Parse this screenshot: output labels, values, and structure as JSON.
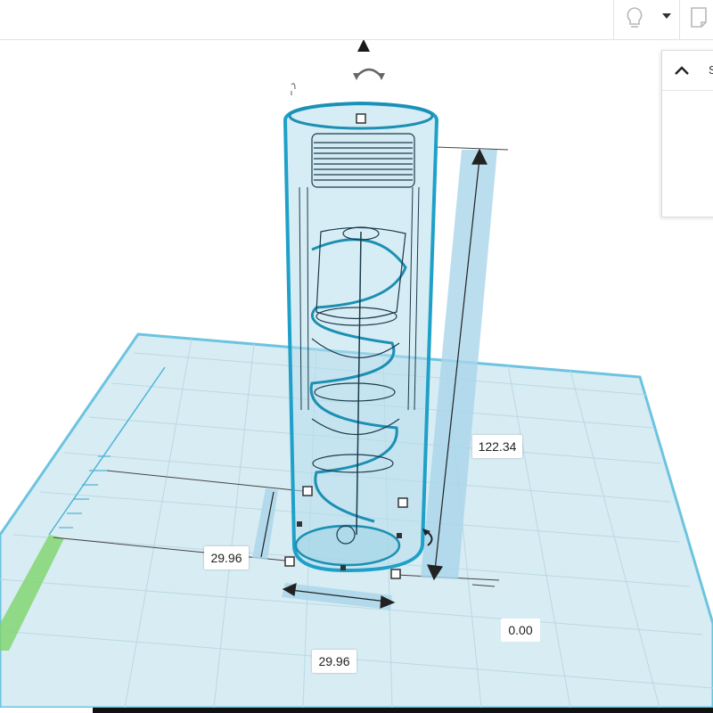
{
  "toolbar": {
    "hint_icon": "lightbulb-icon",
    "menu_icon": "caret-down-icon",
    "notes_icon": "notes-icon"
  },
  "shape_panel": {
    "title": "S",
    "collapse_icon": "chevron-up-icon"
  },
  "dimensions": {
    "height": "122.34",
    "width": "29.96",
    "depth": "29.96",
    "elevation": "0.00"
  },
  "colors": {
    "workplane": "#d8ecf3",
    "grid_line": "#b9d9e6",
    "object_outline": "#1ea0c8",
    "object_fill": "#9fd3e6",
    "dimension_band": "#a9d6ea",
    "ruler_green": "#7ed46a"
  }
}
